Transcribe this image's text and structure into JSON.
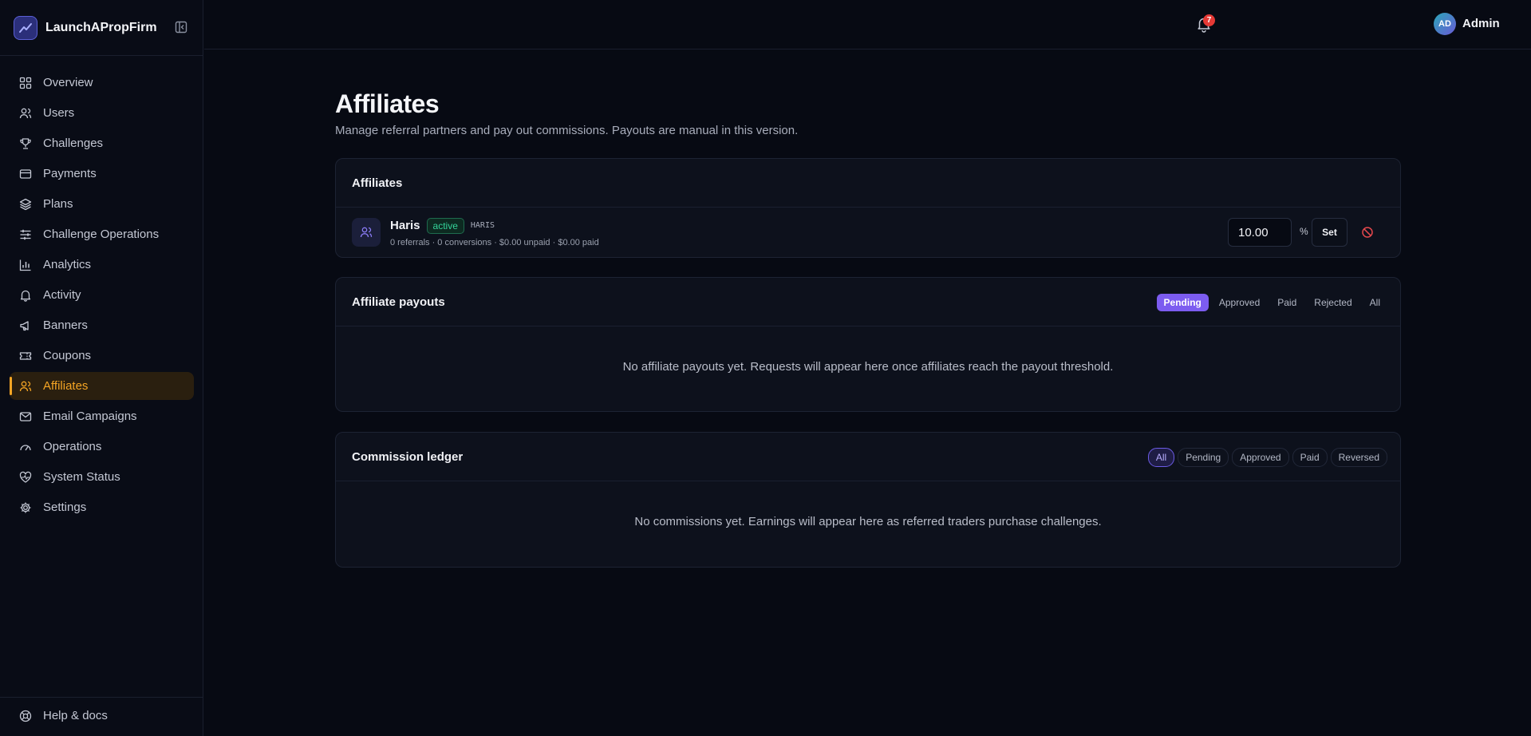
{
  "brand": {
    "name": "LaunchAPropFirm"
  },
  "sidebar": {
    "items": [
      {
        "label": "Overview",
        "icon": "grid-icon"
      },
      {
        "label": "Users",
        "icon": "users-icon"
      },
      {
        "label": "Challenges",
        "icon": "trophy-icon"
      },
      {
        "label": "Payments",
        "icon": "credit-card-icon"
      },
      {
        "label": "Plans",
        "icon": "layers-icon"
      },
      {
        "label": "Challenge Operations",
        "icon": "sliders-icon"
      },
      {
        "label": "Analytics",
        "icon": "bar-chart-icon"
      },
      {
        "label": "Activity",
        "icon": "bell-icon"
      },
      {
        "label": "Banners",
        "icon": "megaphone-icon"
      },
      {
        "label": "Coupons",
        "icon": "ticket-icon"
      },
      {
        "label": "Affiliates",
        "icon": "users-icon",
        "active": true
      },
      {
        "label": "Email Campaigns",
        "icon": "mail-icon"
      },
      {
        "label": "Operations",
        "icon": "gauge-icon"
      },
      {
        "label": "System Status",
        "icon": "heart-pulse-icon"
      },
      {
        "label": "Settings",
        "icon": "gear-icon"
      }
    ],
    "help": "Help & docs"
  },
  "topbar": {
    "notification_count": "7",
    "avatar_initials": "AD",
    "user_name": "Admin"
  },
  "page": {
    "title": "Affiliates",
    "subtitle": "Manage referral partners and pay out commissions. Payouts are manual in this version."
  },
  "affiliates_card": {
    "title": "Affiliates",
    "rows": [
      {
        "name": "Haris",
        "status": "active",
        "code": "HARIS",
        "stats": "0 referrals · 0 conversions · $0.00 unpaid · $0.00 paid",
        "rate": "10.00",
        "rate_unit": "%",
        "set_label": "Set"
      }
    ]
  },
  "payouts_card": {
    "title": "Affiliate payouts",
    "filters": [
      "Pending",
      "Approved",
      "Paid",
      "Rejected",
      "All"
    ],
    "active_filter": "Pending",
    "empty": "No affiliate payouts yet. Requests will appear here once affiliates reach the payout threshold."
  },
  "ledger_card": {
    "title": "Commission ledger",
    "filters": [
      "All",
      "Pending",
      "Approved",
      "Paid",
      "Reversed"
    ],
    "active_filter": "All",
    "empty": "No commissions yet. Earnings will appear here as referred traders purchase challenges."
  },
  "colors": {
    "accent": "#f5a524",
    "primary": "#7c5cf0",
    "success": "#34d399",
    "danger": "#e53935"
  }
}
